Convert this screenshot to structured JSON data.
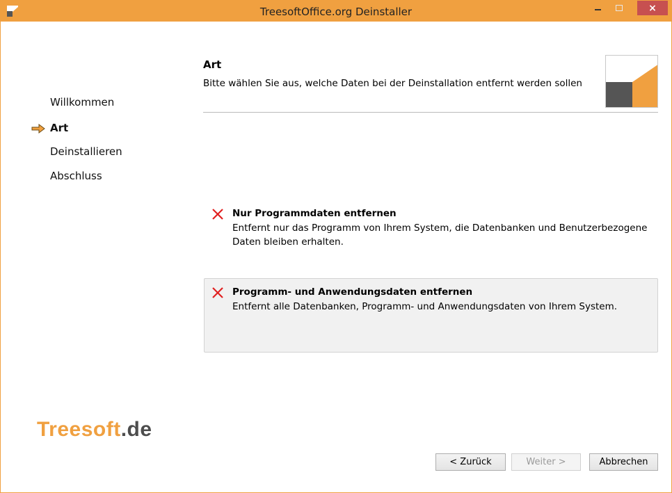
{
  "window": {
    "title": "TreesoftOffice.org Deinstaller",
    "close_glyph": "×",
    "accent": "#f0a040"
  },
  "sidebar": {
    "items": [
      {
        "label": "Willkommen",
        "active": false
      },
      {
        "label": "Art",
        "active": true
      },
      {
        "label": "Deinstallieren",
        "active": false
      },
      {
        "label": "Abschluss",
        "active": false
      }
    ],
    "active_marker_icon": "arrow-right-icon"
  },
  "header": {
    "title": "Art",
    "description": "Bitte wählen Sie aus, welche Daten bei der Deinstallation entfernt werden sollen"
  },
  "options": [
    {
      "title": "Nur Programmdaten entfernen",
      "description": "Entfernt nur das Programm von Ihrem System, die Datenbanken und Benutzerbezogene Daten bleiben erhalten.",
      "icon": "red-x-icon",
      "selected": false
    },
    {
      "title": "Programm- und Anwendungsdaten entfernen",
      "description": "Entfernt alle Datenbanken, Programm- und Anwendungsdaten von Ihrem System.",
      "icon": "red-x-icon",
      "selected": true
    }
  ],
  "brand": {
    "part1": "Treesoft",
    "part2": ".de"
  },
  "buttons": {
    "back": "< Zurück",
    "next": "Weiter >",
    "cancel": "Abbrechen"
  }
}
